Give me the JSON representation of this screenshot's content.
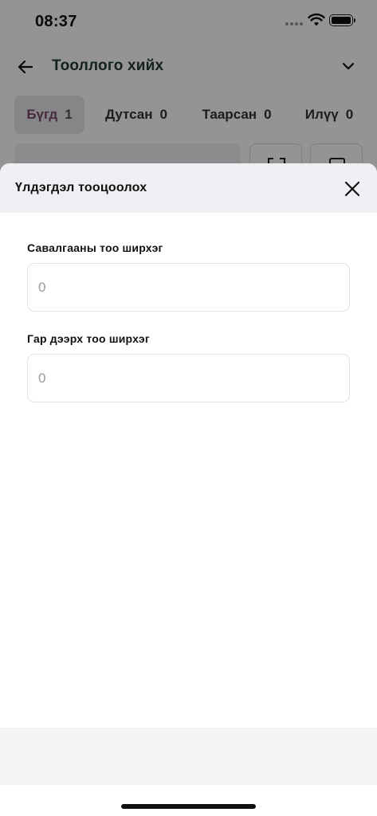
{
  "status_bar": {
    "time": "08:37"
  },
  "header": {
    "title": "Тооллого хийх"
  },
  "tabs": [
    {
      "label": "Бүгд",
      "count": "1",
      "active": true
    },
    {
      "label": "Дутсан",
      "count": "0",
      "active": false
    },
    {
      "label": "Таарсан",
      "count": "0",
      "active": false
    },
    {
      "label": "Илүү",
      "count": "0",
      "active": false
    }
  ],
  "sheet": {
    "title": "Үлдэгдэл тооцоолох",
    "fields": [
      {
        "label": "Савалгааны тоо ширхэг",
        "placeholder": "0"
      },
      {
        "label": "Гар дээрх тоо ширхэг",
        "placeholder": "0"
      }
    ]
  },
  "icons": {
    "back": "arrow-left-icon",
    "chevron": "chevron-down-icon",
    "close": "close-icon",
    "scan": "scan-frame-icon",
    "calculator": "calculator-icon",
    "wifi": "wifi-icon",
    "battery": "battery-icon"
  },
  "colors": {
    "title_green": "#1f3a35",
    "active_tab_text": "#7a4a63",
    "sheet_header_bg": "#efeff4"
  }
}
